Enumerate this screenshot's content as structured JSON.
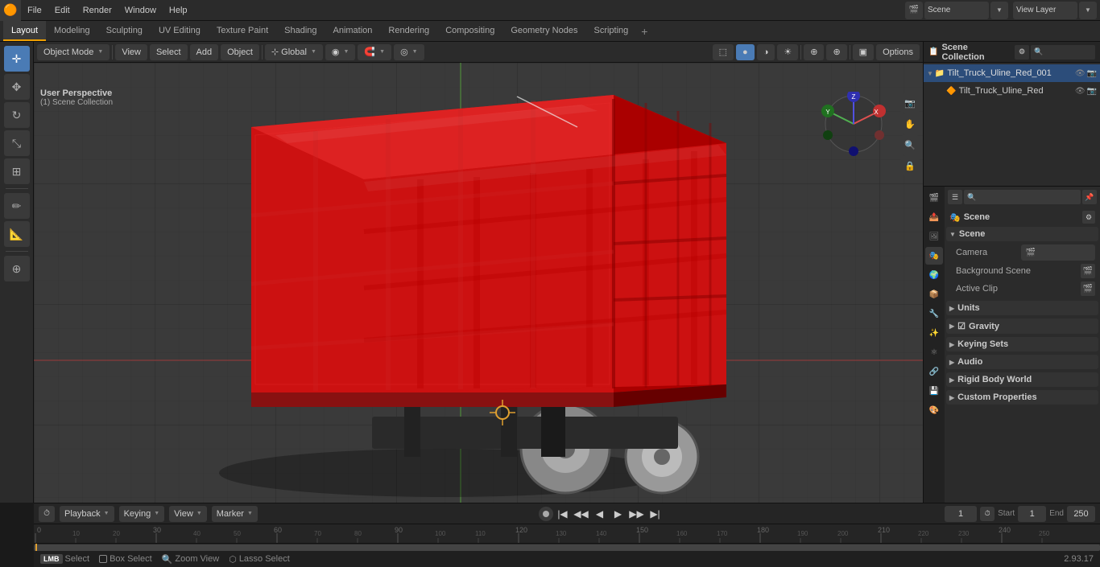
{
  "app": {
    "title": "Blender",
    "logo": "🟠",
    "version": "2.93.17"
  },
  "top_menu": {
    "items": [
      "File",
      "Edit",
      "Render",
      "Window",
      "Help"
    ]
  },
  "workspace_tabs": {
    "tabs": [
      "Layout",
      "Modeling",
      "Sculpting",
      "UV Editing",
      "Texture Paint",
      "Shading",
      "Animation",
      "Rendering",
      "Compositing",
      "Geometry Nodes",
      "Scripting"
    ],
    "active": "Layout",
    "add_label": "+"
  },
  "viewport_header": {
    "mode": "Object Mode",
    "view": "View",
    "select": "Select",
    "add": "Add",
    "object": "Object",
    "transform": "Global",
    "options": "Options"
  },
  "perspective_label": "User Perspective",
  "scene_label": "(1) Scene Collection",
  "toolbar_left": {
    "tools": [
      "cursor",
      "move",
      "rotate",
      "scale",
      "transform",
      "annotate",
      "measure",
      "add_cube"
    ]
  },
  "outliner": {
    "title": "Scene Collection",
    "items": [
      {
        "name": "Tilt_Truck_Uline_Red_001",
        "indent": 1,
        "expanded": true,
        "type": "collection",
        "visible": true
      },
      {
        "name": "Tilt_Truck_Uline_Red",
        "indent": 2,
        "expanded": false,
        "type": "mesh",
        "visible": true
      }
    ]
  },
  "properties": {
    "active_section": "scene",
    "icons": [
      "render",
      "output",
      "view_layer",
      "scene",
      "world",
      "object",
      "modifier",
      "particles",
      "physics",
      "constraints",
      "data",
      "material"
    ],
    "scene_label": "Scene",
    "sections": {
      "scene_header": "Scene",
      "camera_label": "Camera",
      "camera_value": "",
      "background_scene_label": "Background Scene",
      "background_scene_icon": "🎬",
      "active_clip_label": "Active Clip",
      "active_clip_icon": "🎬",
      "units_label": "Units",
      "gravity_label": "Gravity",
      "gravity_checked": true,
      "keying_sets_label": "Keying Sets",
      "audio_label": "Audio",
      "rigid_body_world_label": "Rigid Body World",
      "custom_properties_label": "Custom Properties"
    }
  },
  "timeline": {
    "playback_label": "Playback",
    "keying_label": "Keying",
    "view_label": "View",
    "marker_label": "Marker",
    "current_frame": "1",
    "start_label": "Start",
    "start_value": "1",
    "end_label": "End",
    "end_value": "250",
    "ruler_marks": [
      "0",
      "50",
      "100",
      "150",
      "200",
      "250"
    ],
    "ruler_marks_detail": [
      "0",
      "10",
      "20",
      "30",
      "40",
      "50",
      "60",
      "70",
      "80",
      "90",
      "100",
      "110",
      "120",
      "130",
      "140",
      "150",
      "160",
      "170",
      "180",
      "190",
      "200",
      "210",
      "220",
      "230",
      "240",
      "250"
    ]
  },
  "status_bar": {
    "select_label": "Select",
    "box_select_label": "Box Select",
    "zoom_view_label": "Zoom View",
    "lasso_select_label": "Lasso Select",
    "coordinates": "2.93.17"
  }
}
